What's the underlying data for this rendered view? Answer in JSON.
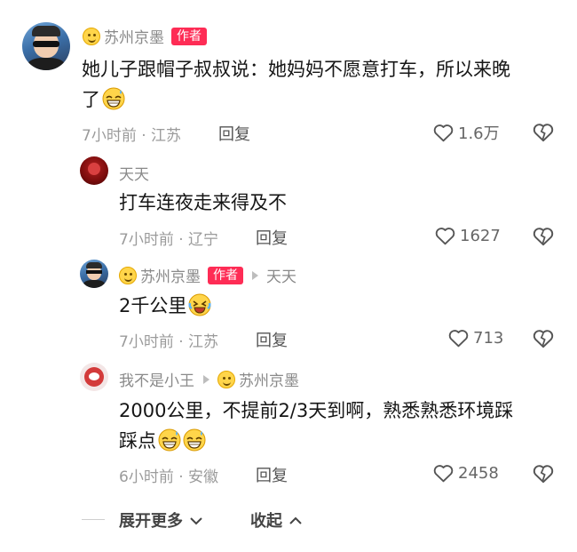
{
  "comments": [
    {
      "author": "苏州京墨",
      "badge": "作者",
      "text_line1": "她儿子跟帽子叔叔说：她妈妈不愿意打车，所以来晚",
      "text_line2": "了",
      "time": "7小时前 · 江苏",
      "reply": "回复",
      "likes": "1.6万",
      "emojis": [
        "grinning-sweat"
      ]
    },
    {
      "author": "天天",
      "text": "打车连夜走来得及不",
      "time": "7小时前 · 辽宁",
      "reply": "回复",
      "likes": "1627"
    },
    {
      "author": "苏州京墨",
      "badge": "作者",
      "reply_to": "天天",
      "text": "2千公里",
      "time": "7小时前 · 江苏",
      "reply": "回复",
      "likes": "713",
      "emojis": [
        "rolling-laughing"
      ]
    },
    {
      "author": "我不是小王",
      "reply_to": "苏州京墨",
      "text_line1": "2000公里，不提前2/3天到啊，熟悉熟悉环境踩",
      "text_line2": "踩点",
      "time": "6小时前 · 安徽",
      "reply": "回复",
      "likes": "2458",
      "emojis": [
        "grinning-sweat",
        "grinning-sweat"
      ]
    }
  ],
  "footer": {
    "expand_more": "展开更多",
    "collapse": "收起"
  },
  "icons": {
    "like": "heart-outline-icon",
    "dislike": "broken-heart-icon",
    "expand": "chevron-down-icon",
    "collapse": "chevron-up-icon"
  },
  "colors": {
    "badge": "#fe2c55",
    "meta": "#9b9b9b",
    "name": "#8a8a8a"
  }
}
